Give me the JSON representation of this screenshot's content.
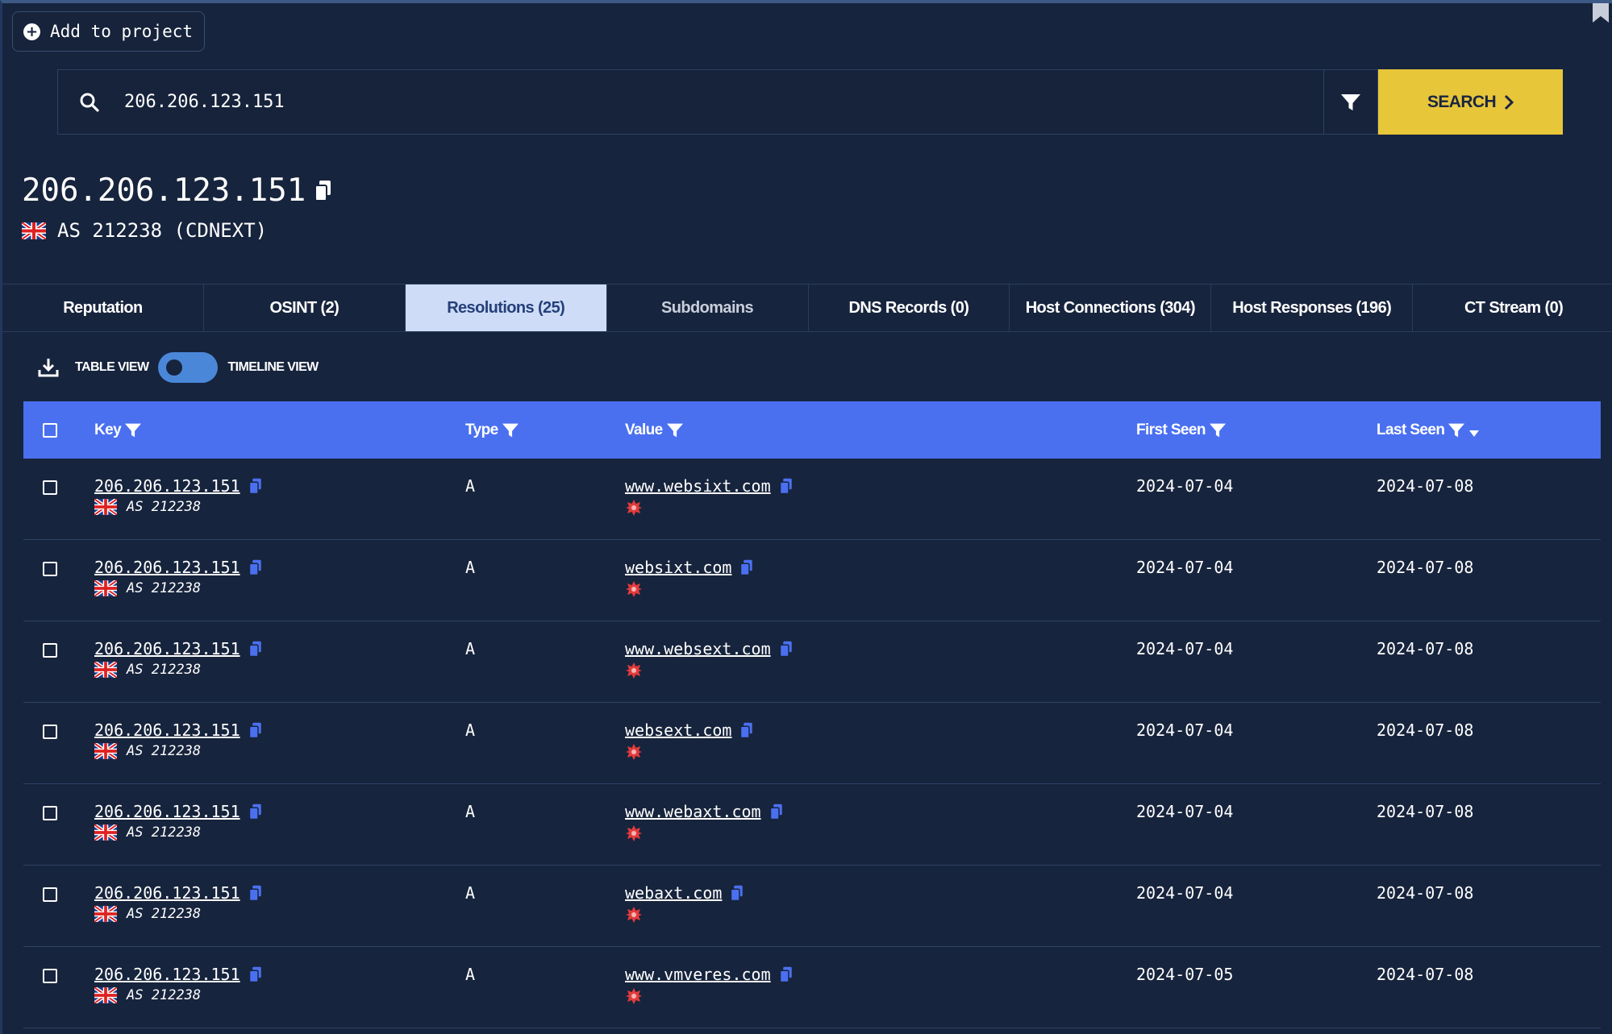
{
  "add_to_project": {
    "label": "Add to project"
  },
  "search": {
    "value": "206.206.123.151",
    "button_label": "SEARCH"
  },
  "header": {
    "ip": "206.206.123.151",
    "asn": "AS 212238 (CDNEXT)"
  },
  "tabs": [
    {
      "label": "Reputation",
      "active": false
    },
    {
      "label": "OSINT (2)",
      "active": false
    },
    {
      "label": "Resolutions (25)",
      "active": true
    },
    {
      "label": "Subdomains",
      "active": false
    },
    {
      "label": "DNS Records (0)",
      "active": false
    },
    {
      "label": "Host Connections (304)",
      "active": false
    },
    {
      "label": "Host Responses (196)",
      "active": false
    },
    {
      "label": "CT Stream (0)",
      "active": false
    }
  ],
  "view": {
    "table_label": "TABLE VIEW",
    "timeline_label": "TIMELINE VIEW"
  },
  "table": {
    "columns": {
      "key": "Key",
      "type": "Type",
      "value": "Value",
      "first_seen": "First Seen",
      "last_seen": "Last Seen"
    },
    "rows": [
      {
        "key": "206.206.123.151",
        "asn": "AS 212238",
        "type": "A",
        "value": "www.websixt.com",
        "first_seen": "2024-07-04",
        "last_seen": "2024-07-08"
      },
      {
        "key": "206.206.123.151",
        "asn": "AS 212238",
        "type": "A",
        "value": "websixt.com",
        "first_seen": "2024-07-04",
        "last_seen": "2024-07-08"
      },
      {
        "key": "206.206.123.151",
        "asn": "AS 212238",
        "type": "A",
        "value": "www.websext.com",
        "first_seen": "2024-07-04",
        "last_seen": "2024-07-08"
      },
      {
        "key": "206.206.123.151",
        "asn": "AS 212238",
        "type": "A",
        "value": "websext.com",
        "first_seen": "2024-07-04",
        "last_seen": "2024-07-08"
      },
      {
        "key": "206.206.123.151",
        "asn": "AS 212238",
        "type": "A",
        "value": "www.webaxt.com",
        "first_seen": "2024-07-04",
        "last_seen": "2024-07-08"
      },
      {
        "key": "206.206.123.151",
        "asn": "AS 212238",
        "type": "A",
        "value": "webaxt.com",
        "first_seen": "2024-07-04",
        "last_seen": "2024-07-08"
      },
      {
        "key": "206.206.123.151",
        "asn": "AS 212238",
        "type": "A",
        "value": "www.vmveres.com",
        "first_seen": "2024-07-05",
        "last_seen": "2024-07-08"
      }
    ]
  },
  "colors": {
    "background": "#17243d",
    "accent_blue": "#4a70f0",
    "search_yellow": "#e8c63a",
    "active_tab": "#cfdcf7",
    "malicious_red": "#e23b3b"
  },
  "icons": {
    "search": "search-icon",
    "filter": "filter-icon",
    "copy": "copy-icon",
    "flag": "uk-flag-icon",
    "malicious": "malicious-badge-icon",
    "download": "download-icon",
    "bookmark": "bookmark-icon",
    "sort": "sort-desc-icon"
  }
}
